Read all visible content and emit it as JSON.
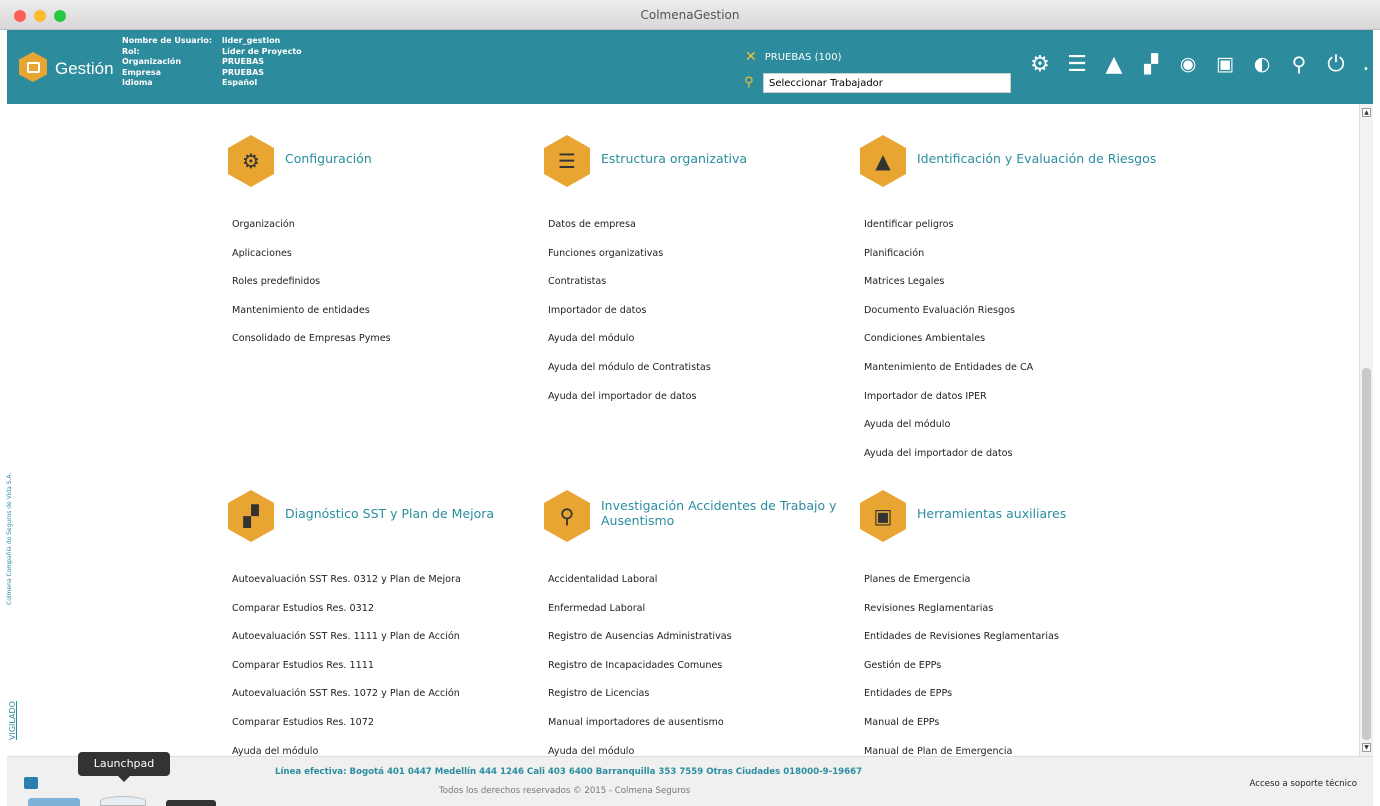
{
  "window": {
    "title": "ColmenaGestion"
  },
  "header": {
    "logo_text": "Gestión",
    "info_labels": [
      "Nombre de Usuario:",
      "Rol:",
      "Organización",
      "Empresa",
      "Idioma"
    ],
    "info_values": [
      "lider_gestion",
      "Líder de Proyecto",
      "PRUEBAS",
      "PRUEBAS",
      "Español"
    ],
    "company_selector": "PRUEBAS (100)",
    "worker_search_value": "Seleccionar Trabajador",
    "toolbar_icons": [
      "gear-icon",
      "list-icon",
      "warning-icon",
      "puzzle-icon",
      "search-person-icon",
      "briefcase-icon",
      "head-icon",
      "search-icon",
      "power-icon"
    ]
  },
  "sections": [
    {
      "icon": "gear-icon",
      "glyph": "⚙",
      "title": "Configuración",
      "items": [
        "Organización",
        "Aplicaciones",
        "Roles predefinidos",
        "Mantenimiento de entidades",
        "Consolidado de Empresas Pymes"
      ]
    },
    {
      "icon": "list-icon",
      "glyph": "☰",
      "title": "Estructura organizativa",
      "items": [
        "Datos de empresa",
        "Funciones organizativas",
        "Contratistas",
        "Importador de datos",
        "Ayuda del módulo",
        "Ayuda del módulo de Contratistas",
        "Ayuda del importador de datos"
      ]
    },
    {
      "icon": "warning-icon",
      "glyph": "▲",
      "title": "Identificación y Evaluación de Riesgos",
      "items": [
        "Identificar peligros",
        "Planificación",
        "Matrices Legales",
        "Documento Evaluación Riesgos",
        "Condiciones Ambientales",
        "Mantenimiento de Entidades de CA",
        "Importador de datos IPER",
        "Ayuda del módulo",
        "Ayuda del importador de datos"
      ]
    },
    {
      "icon": "puzzle-icon",
      "glyph": "▞",
      "title": "Diagnóstico SST y Plan de Mejora",
      "items": [
        "Autoevaluación SST Res. 0312 y Plan de Mejora",
        "Comparar Estudios Res. 0312",
        "Autoevaluación SST Res. 1111 y Plan de Acción",
        "Comparar Estudios Res. 1111",
        "Autoevaluación SST Res. 1072 y Plan de Acción",
        "Comparar Estudios Res. 1072",
        "Ayuda del módulo"
      ]
    },
    {
      "icon": "search-person-icon",
      "glyph": "🔍",
      "title": "Investigación Accidentes de Trabajo y Ausentismo",
      "items": [
        "Accidentalidad Laboral",
        "Enfermedad Laboral",
        "Registro de Ausencias Administrativas",
        "Registro de Incapacidades Comunes",
        "Registro de Licencias",
        "Manual importadores de ausentismo",
        "Ayuda del módulo"
      ]
    },
    {
      "icon": "briefcase-icon",
      "glyph": "▣",
      "title": "Herramientas auxiliares",
      "items": [
        "Planes de Emergencia",
        "Revisiones Reglamentarias",
        "Entidades de Revisiones Reglamentarias",
        "Gestión de EPPs",
        "Entidades de EPPs",
        "Manual de EPPs",
        "Manual de Plan de Emergencia"
      ]
    }
  ],
  "side_text": {
    "company": "Colmena Compañía de Seguros de Vida S.A.",
    "link": "VIGILADO"
  },
  "footer": {
    "hotline": "Línea efectiva: Bogotá 401 0447 Medellín 444 1246 Cali 403 6400 Barranquilla 353 7559 Otras Ciudades 018000-9-19667",
    "copyright": "Todos los derechos reservados © 2015 - Colmena Seguros",
    "support_link": "Acceso a soporte técnico"
  },
  "dock": {
    "tooltip": "Launchpad"
  }
}
